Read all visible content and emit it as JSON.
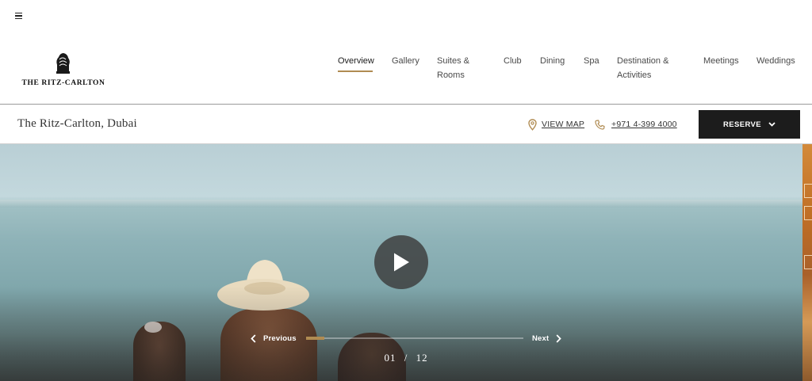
{
  "header": {
    "brand": "THE RITZ-CARLTON",
    "menu_icon": "hamburger-icon",
    "crest_icon": "lion-crest-icon",
    "nav": [
      {
        "label": "Overview",
        "line2": "",
        "active": true
      },
      {
        "label": "Gallery",
        "line2": "",
        "active": false
      },
      {
        "label": "Suites &",
        "line2": "Rooms",
        "active": false
      },
      {
        "label": "Club",
        "line2": "",
        "active": false
      },
      {
        "label": "Dining",
        "line2": "",
        "active": false
      },
      {
        "label": "Spa",
        "line2": "",
        "active": false
      },
      {
        "label": "Destination &",
        "line2": "Activities",
        "active": false
      },
      {
        "label": "Meetings",
        "line2": "",
        "active": false
      },
      {
        "label": "Weddings",
        "line2": "",
        "active": false
      }
    ]
  },
  "subbar": {
    "hotel_name": "The Ritz-Carlton, Dubai",
    "map_label": "VIEW MAP",
    "map_icon": "map-pin-icon",
    "phone_label": "+971 4-399 4000",
    "phone_icon": "phone-icon",
    "reserve_label": "RESERVE",
    "reserve_icon": "chevron-down-icon"
  },
  "hero": {
    "play_icon": "play-icon",
    "prev_label": "Previous",
    "prev_icon": "chevron-left-icon",
    "next_label": "Next",
    "next_icon": "chevron-right-icon",
    "current_slide": "01",
    "separator": "/",
    "total_slides": "12",
    "progress_fraction": 0.083
  },
  "colors": {
    "accent_gold": "#b08b52",
    "reserve_bg": "#1c1c1c",
    "text_dark": "#1c1c1c"
  }
}
